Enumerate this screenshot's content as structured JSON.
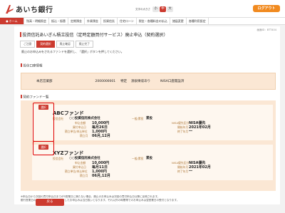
{
  "header": {
    "bank_name": "あいち銀行",
    "fontsize_label": "文字の大きさ",
    "fontsize_options": [
      "小",
      "中",
      "大"
    ],
    "fontsize_active": "中",
    "logout_label": "ログアウト"
  },
  "nav": {
    "items": [
      "ホーム",
      "残高・明細照会",
      "振込・振替",
      "定期預金",
      "外貨預金",
      "投資信託",
      "住宅ローン",
      "税金・各種料金の払込",
      "諸届変更",
      "各種利用設定"
    ]
  },
  "page": {
    "title": "投資信託あいぎん積立投信（定時定額買付サービス）廃止申込（契約選択）",
    "screen_id": "画面ID：BTT404",
    "steps": [
      "ご注意",
      "契約選択",
      "廃止確認",
      "廃止完了"
    ],
    "current_step": 1,
    "instruction": "廃止のお申込みをされるファンドを選択し、「選択」ボタンを押してください。"
  },
  "account": {
    "section_title": "投信口座情報",
    "branch": "本店営業部",
    "account_number": "2000000001",
    "category": "特定",
    "withholding": "源泉徴収あり",
    "nisa": "NISA口座開設済"
  },
  "funds": {
    "section_title": "契約ファンド一覧",
    "select_label": "選択",
    "labels": {
      "company": "投信会社",
      "amount": "申込金額",
      "buy_date": "買付申込日",
      "interval": "積立単位/申込単位",
      "month": "積立月",
      "class": "一般/累投",
      "nisa": "NISA優先区分",
      "start": "開始年月",
      "end": "終了年月"
    },
    "items": [
      {
        "name": "ABCファンド",
        "company": "○○投資信託株式会社",
        "class_value": "累投",
        "amount": "10,000円",
        "buy_date": "毎月26日",
        "interval": "1,000円",
        "month": "06月,12月",
        "nisa": "NISA優先",
        "start": "2021年02月",
        "end": "―"
      },
      {
        "name": "XYZファンド",
        "company": "○○投資信託株式会社",
        "class_value": "累投",
        "amount": "10,000円",
        "buy_date": "毎月11日",
        "interval": "1,000円",
        "month": "06月,12月",
        "nisa": "NISA優先",
        "start": "2021年02月",
        "end": "―"
      }
    ]
  },
  "note": {
    "line1": "※申込日から次回の買付申込日までが5営業日に満たない場合、廃止のお申込みは次回の買付申込日以降に反映されます。",
    "line2": "銀行営業日の8:00〜15:00までに受付したお申込みは当日扱いとなります。それ以外の時間帯でのお申込みは翌営業日の受付となります。"
  },
  "back_label": "戻る"
}
